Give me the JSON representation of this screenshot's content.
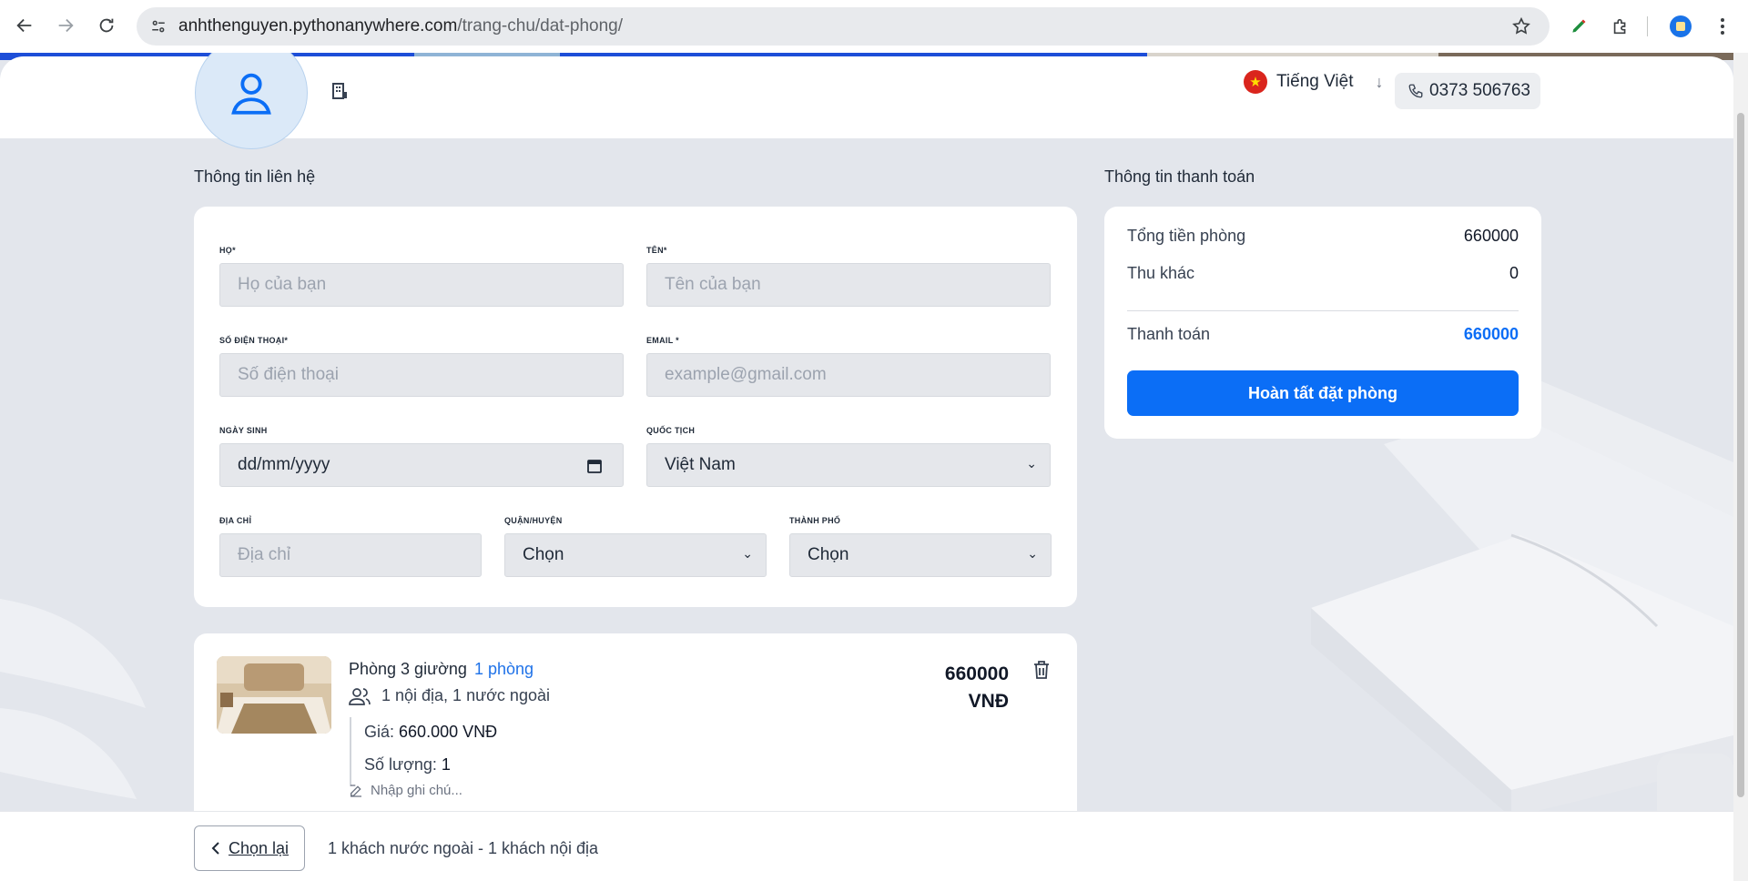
{
  "browser": {
    "url_host": "anhthenguyen.pythonanywhere.com",
    "url_path": "/trang-chu/dat-phong/"
  },
  "header": {
    "language": "Tiếng Việt",
    "phone": "0373 506763",
    "flag_star": "★"
  },
  "contact": {
    "title": "Thông tin liên hệ",
    "last_name_label": "HỌ*",
    "last_name_placeholder": "Họ của bạn",
    "first_name_label": "TÊN*",
    "first_name_placeholder": "Tên của bạn",
    "phone_label": "SỐ ĐIỆN THOẠI*",
    "phone_placeholder": "Số điện thoại",
    "email_label": "EMAIL *",
    "email_placeholder": "example@gmail.com",
    "dob_label": "NGÀY SINH",
    "dob_value": "dd/mm/yyyy",
    "nationality_label": "QUỐC TỊCH",
    "nationality_value": "Việt Nam",
    "address_label": "ĐỊA CHỈ",
    "address_placeholder": "Địa chỉ",
    "district_label": "QUẬN/HUYỆN",
    "district_value": "Chọn",
    "city_label": "THÀNH PHỐ",
    "city_value": "Chọn"
  },
  "payment": {
    "title": "Thông tin thanh toán",
    "room_total_label": "Tổng tiền phòng",
    "room_total_value": "660000",
    "other_label": "Thu khác",
    "other_value": "0",
    "pay_label": "Thanh toán",
    "pay_value": "660000",
    "submit_label": "Hoàn tất đặt phòng",
    "accent_color": "#0b6ef6"
  },
  "room": {
    "name": "Phòng 3 giường",
    "count": "1 phòng",
    "guests": "1 nội địa, 1 nước ngoài",
    "price_label": "Giá:",
    "price_value": "660.000 VNĐ",
    "qty_label": "Số lượng:",
    "qty_value": "1",
    "note_placeholder": "Nhập ghi chú...",
    "total": "660000",
    "currency": "VNĐ"
  },
  "footer": {
    "back_label": "Chọn lại",
    "summary": "1 khách nước ngoài - 1 khách nội địa"
  }
}
